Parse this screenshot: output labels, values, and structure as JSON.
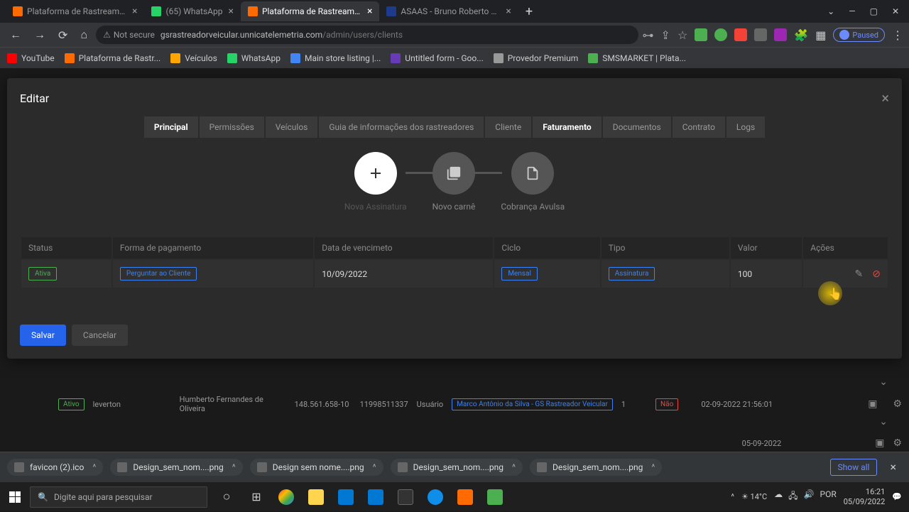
{
  "browser": {
    "tabs": [
      {
        "title": "Plataforma de Rastreamento e g",
        "favicon": "#ff6b00"
      },
      {
        "title": "(65) WhatsApp",
        "favicon": "#25d366"
      },
      {
        "title": "Plataforma de Rastreamento e g",
        "favicon": "#ff6b00",
        "active": true
      },
      {
        "title": "ASAAS - Bruno Roberto Vieira d",
        "favicon": "#1e3a8a"
      }
    ],
    "not_secure": "Not secure",
    "url_host": "gsrastreadorveicular.unnicatelemetria.com",
    "url_path": "/admin/users/clients",
    "paused": "Paused"
  },
  "bookmarks": [
    {
      "label": "YouTube",
      "color": "#ff0000"
    },
    {
      "label": "Plataforma de Rastr...",
      "color": "#ff6b00"
    },
    {
      "label": "Veículos",
      "color": "#ffa500"
    },
    {
      "label": "WhatsApp",
      "color": "#25d366"
    },
    {
      "label": "Main store listing |...",
      "color": "#4285f4"
    },
    {
      "label": "Untitled form - Goo...",
      "color": "#673ab7"
    },
    {
      "label": "Provedor Premium",
      "color": "#999"
    },
    {
      "label": "SMSMARKET | Plata...",
      "color": "#4caf50"
    }
  ],
  "modal": {
    "title": "Editar",
    "tabs": {
      "principal": "Principal",
      "permissoes": "Permissões",
      "veiculos": "Veículos",
      "guia": "Guia de informações dos rastreadores",
      "cliente": "Cliente",
      "faturamento": "Faturamento",
      "documentos": "Documentos",
      "contrato": "Contrato",
      "logs": "Logs"
    },
    "steps": {
      "nova_assinatura": "Nova Assinatura",
      "novo_carne": "Novo carnê",
      "cobranca_avulsa": "Cobrança Avulsa"
    },
    "table": {
      "headers": {
        "status": "Status",
        "forma": "Forma de pagamento",
        "data": "Data de vencimeto",
        "ciclo": "Ciclo",
        "tipo": "Tipo",
        "valor": "Valor",
        "acoes": "Ações"
      },
      "row": {
        "status": "Ativa",
        "forma": "Perguntar ao Cliente",
        "data": "10/09/2022",
        "ciclo": "Mensal",
        "tipo": "Assinatura",
        "valor": "100"
      }
    },
    "save": "Salvar",
    "cancel": "Cancelar"
  },
  "bg_row": {
    "status": "Ativo",
    "user": "leverton",
    "name": "Humberto Fernandes de Oliveira",
    "cpf": "148.561.658-10",
    "phone": "11998511337",
    "type": "Usuário",
    "seller": "Marco Antônio da Silva - GS Rastreador Veicular",
    "count": "1",
    "nao": "Não",
    "date": "02-09-2022 21:56:01",
    "date2": "05-09-2022"
  },
  "downloads": {
    "items": [
      "favicon (2).ico",
      "Design_sem_nom....png",
      "Design sem nome....png",
      "Design_sem_nom....png",
      "Design_sem_nom....png"
    ],
    "show_all": "Show all"
  },
  "taskbar": {
    "search_placeholder": "Digite aqui para pesquisar",
    "temp": "14°C",
    "time": "16:21",
    "date": "05/09/2022"
  }
}
